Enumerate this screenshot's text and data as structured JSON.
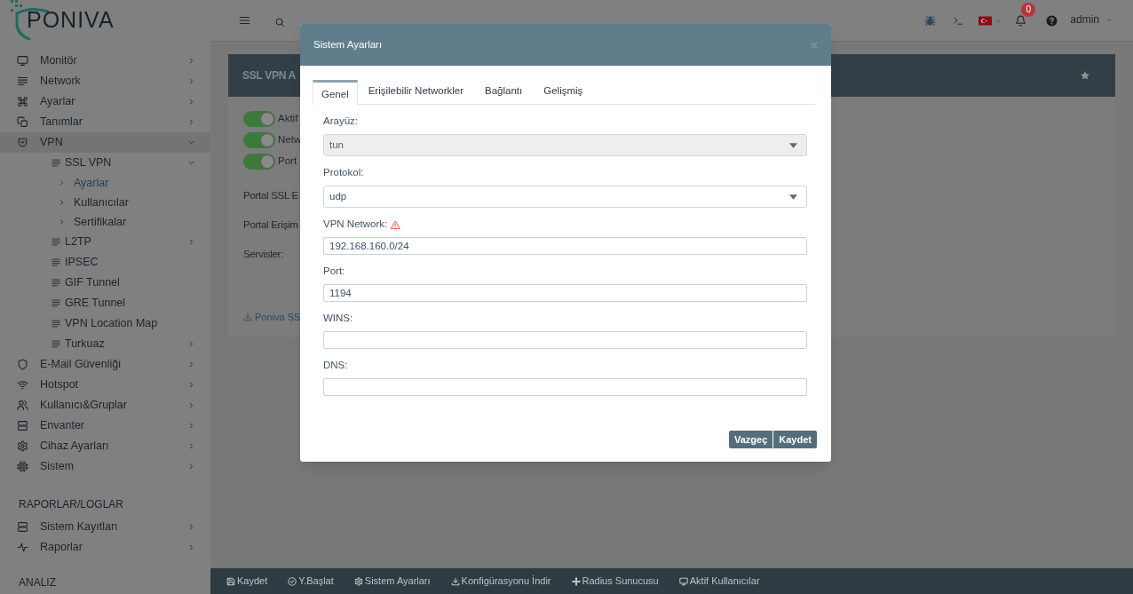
{
  "header": {
    "logo": "PONIVA",
    "notifications": "0",
    "user": "admin"
  },
  "sidebar": {
    "sections": [
      {
        "items": [
          {
            "label": "Monitör",
            "selected": false,
            "expanded": false
          },
          {
            "label": "Network",
            "selected": false,
            "expanded": false
          },
          {
            "label": "Ayarlar",
            "selected": false,
            "expanded": false
          },
          {
            "label": "Tanımlar",
            "selected": false,
            "expanded": false
          },
          {
            "label": "VPN",
            "selected": true,
            "expanded": true,
            "children": [
              {
                "label": "SSL VPN",
                "selected": false,
                "expanded": true,
                "children": [
                  {
                    "label": "Ayarlar",
                    "selected": true
                  },
                  {
                    "label": "Kullanıcılar",
                    "selected": false
                  },
                  {
                    "label": "Sertifikalar",
                    "selected": false
                  }
                ]
              },
              {
                "label": "L2TP",
                "selected": false,
                "expanded": false
              },
              {
                "label": "IPSEC",
                "selected": false
              },
              {
                "label": "GIF Tunnel",
                "selected": false
              },
              {
                "label": "GRE Tunnel",
                "selected": false
              },
              {
                "label": "VPN Location Map",
                "selected": false
              },
              {
                "label": "Turkuaz",
                "selected": false,
                "expanded": false
              }
            ]
          },
          {
            "label": "E-Mail Güvenliği",
            "selected": false,
            "expanded": false
          },
          {
            "label": "Hotspot",
            "selected": false,
            "expanded": false
          },
          {
            "label": "Kullanıcı&Gruplar",
            "selected": false,
            "expanded": false
          },
          {
            "label": "Envanter",
            "selected": false,
            "expanded": false
          },
          {
            "label": "Cihaz Ayarları",
            "selected": false,
            "expanded": false
          },
          {
            "label": "Sistem",
            "selected": false,
            "expanded": false
          }
        ]
      },
      {
        "title": "RAPORLAR/LOGLAR",
        "items": [
          {
            "label": "Sistem Kayıtları",
            "selected": false,
            "expanded": false
          },
          {
            "label": "Raporlar",
            "selected": false,
            "expanded": false
          }
        ]
      },
      {
        "title": "ANALIZ"
      }
    ]
  },
  "page": {
    "card_title": "SSL VPN A",
    "toggles": [
      {
        "label": "Aktif",
        "on": true
      },
      {
        "label": "Netw",
        "on": true
      },
      {
        "label": "Port",
        "on": true
      }
    ],
    "fields": [
      "Portal SSL E",
      "Portal Erişim",
      "Servisler:"
    ],
    "download_link": "Poniva SS"
  },
  "dialog": {
    "title": "Sistem Ayarları",
    "tabs": [
      {
        "label": "Genel",
        "selected": true
      },
      {
        "label": "Erişilebilir Networkler",
        "selected": false
      },
      {
        "label": "Bağlantı",
        "selected": false
      },
      {
        "label": "Gelişmiş",
        "selected": false
      }
    ],
    "fields": [
      {
        "label": "Arayüz:",
        "kind": "select",
        "value": "tun",
        "disabled": true,
        "warning": false
      },
      {
        "label": "Protokol:",
        "kind": "select",
        "value": "udp",
        "disabled": false,
        "warning": false
      },
      {
        "label": "VPN Network:",
        "kind": "text",
        "value": "192.168.160.0/24",
        "disabled": false,
        "warning": true
      },
      {
        "label": "Port:",
        "kind": "text",
        "value": "1194",
        "disabled": false,
        "warning": false
      },
      {
        "label": "WINS:",
        "kind": "text",
        "disabled": false,
        "warning": false
      },
      {
        "label": "DNS:",
        "kind": "text",
        "disabled": false,
        "warning": false
      }
    ],
    "buttons": [
      "Vazgeç",
      "Kaydet"
    ]
  },
  "toolbar": [
    "Kaydet",
    "Y.Başlat",
    "Sistem Ayarları",
    "Konfigürasyonu İndir",
    "Radius Sunucusu",
    "Aktif Kullanıcılar"
  ]
}
